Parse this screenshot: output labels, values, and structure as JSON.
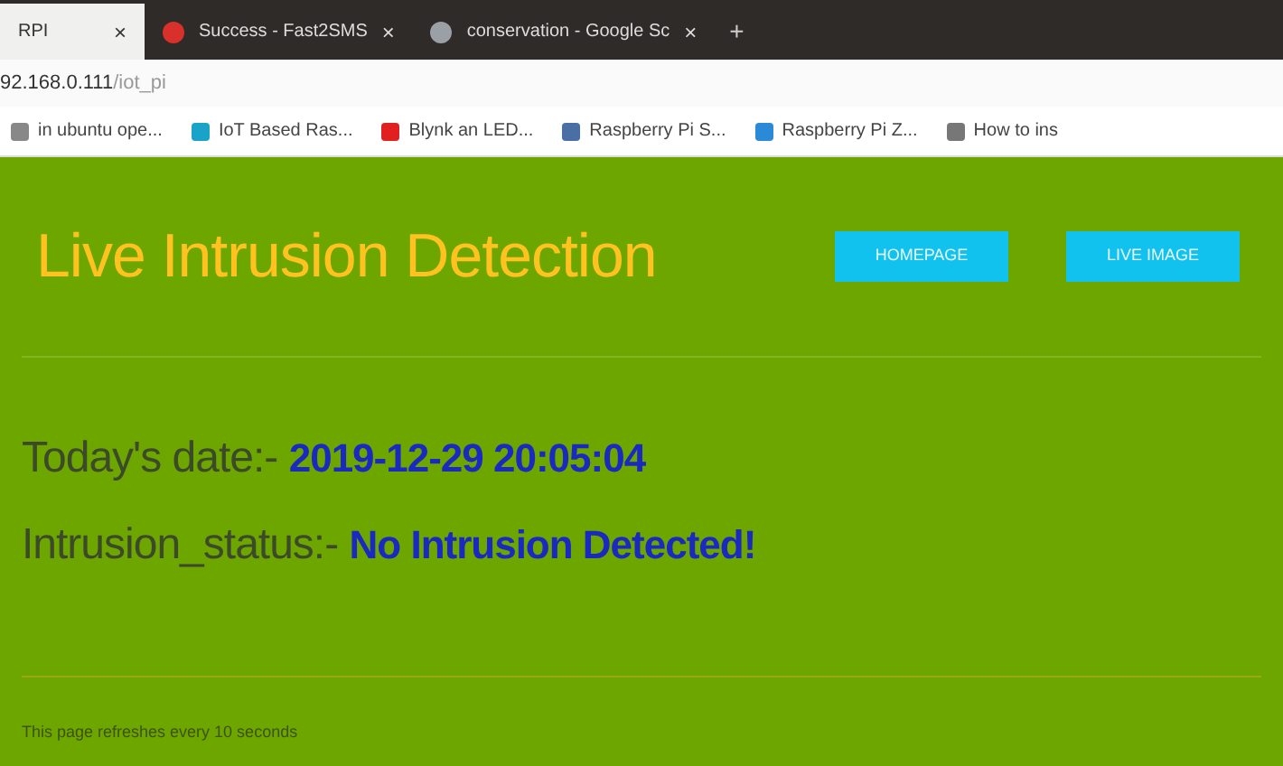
{
  "browser": {
    "tabs": [
      {
        "title": "RPI",
        "close": "×",
        "selected": true
      },
      {
        "title": "Success - Fast2SMS",
        "close": "×",
        "selected": false,
        "color": "#d9302c"
      },
      {
        "title": "conservation - Google Sc",
        "close": "×",
        "selected": false,
        "color": "#9aa0a6"
      }
    ],
    "new_tab": "+",
    "address": {
      "host": "92.168.0.111",
      "path": "/iot_pi"
    },
    "bookmarks": [
      {
        "label": "in ubuntu ope...",
        "color": "#888888"
      },
      {
        "label": "IoT Based Ras...",
        "color": "#1aa3c8"
      },
      {
        "label": "Blynk an LED...",
        "color": "#e02020"
      },
      {
        "label": "Raspberry Pi S...",
        "color": "#4a6fa5"
      },
      {
        "label": "Raspberry Pi Z...",
        "color": "#2a8ad8"
      },
      {
        "label": "How to ins",
        "color": "#777777"
      }
    ]
  },
  "page": {
    "heading": "Live Intrusion Detection",
    "buttons": [
      "HOMEPAGE",
      "LIVE IMAGE"
    ],
    "date_label": "Today's date:-",
    "date_value": "2019-12-29 20:05:04",
    "status_label": "Intrusion_status:-",
    "status_value": "No Intrusion Detected!",
    "footer": "This page refreshes every 10 seconds"
  }
}
